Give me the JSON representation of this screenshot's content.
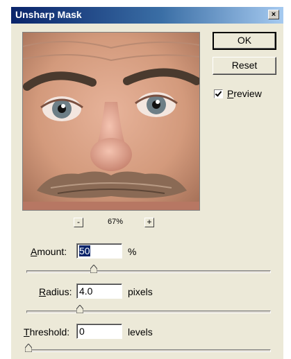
{
  "window": {
    "title": "Unsharp Mask",
    "close_glyph": "×"
  },
  "preview": {
    "image": "face-close-up-with-mustache",
    "zoom": "67%",
    "zoom_out": "-",
    "zoom_in": "+"
  },
  "buttons": {
    "ok": "OK",
    "reset": "Reset"
  },
  "preview_checkbox": {
    "checked": true,
    "label_prefix": "",
    "label_underlined": "P",
    "label_rest": "review"
  },
  "amount": {
    "label_underlined": "A",
    "label_rest": "mount:",
    "value": "50",
    "unit": "%",
    "slider_fraction": 0.21
  },
  "radius": {
    "label_underlined": "R",
    "label_rest": "adius:",
    "value": "4.0",
    "unit": "pixels",
    "slider_fraction": 0.21
  },
  "threshold": {
    "label_underlined": "T",
    "label_rest": "hreshold:",
    "value": "0",
    "unit": "levels",
    "slider_fraction": 0.0
  },
  "colors": {
    "title_start": "#0a246a",
    "title_end": "#a6caf0",
    "dialog_bg": "#ece9d8",
    "selection": "#0a246a"
  }
}
